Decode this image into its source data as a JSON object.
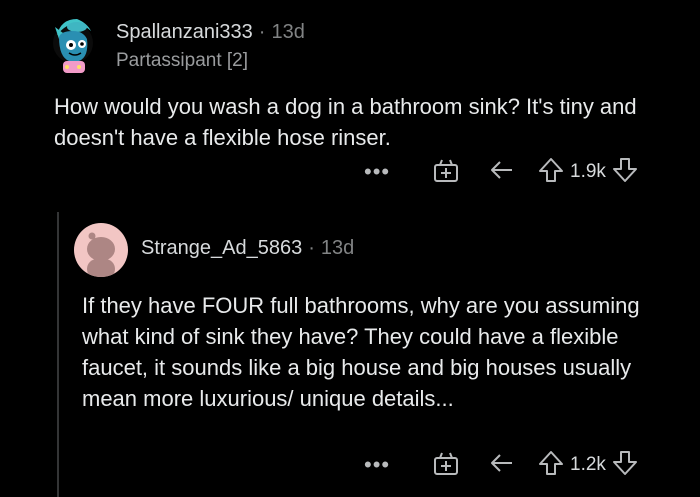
{
  "comments": [
    {
      "username": "Spallanzani333",
      "separator": "·",
      "age": "13d",
      "flair": "Partassipant [2]",
      "body": "How would you wash a dog in a bathroom sink? It's tiny and doesn't have a flexible hose rinser.",
      "more_label": "•••",
      "score": "1.9k"
    },
    {
      "username": "Strange_Ad_5863",
      "separator": "·",
      "age": "13d",
      "body": "If they have FOUR full bathrooms, why are you assuming what kind of sink they have? They could have a flexible faucet, it sounds like a big house and big houses usually mean more luxurious/ unique details...",
      "more_label": "•••",
      "score": "1.2k"
    }
  ],
  "colors": {
    "background": "#000000",
    "text": "#d7dadc",
    "muted": "#818384",
    "avatar2_bg": "#f2c6c4"
  },
  "icons": [
    "more-icon",
    "award-icon",
    "reply-icon",
    "upvote-icon",
    "downvote-icon"
  ]
}
